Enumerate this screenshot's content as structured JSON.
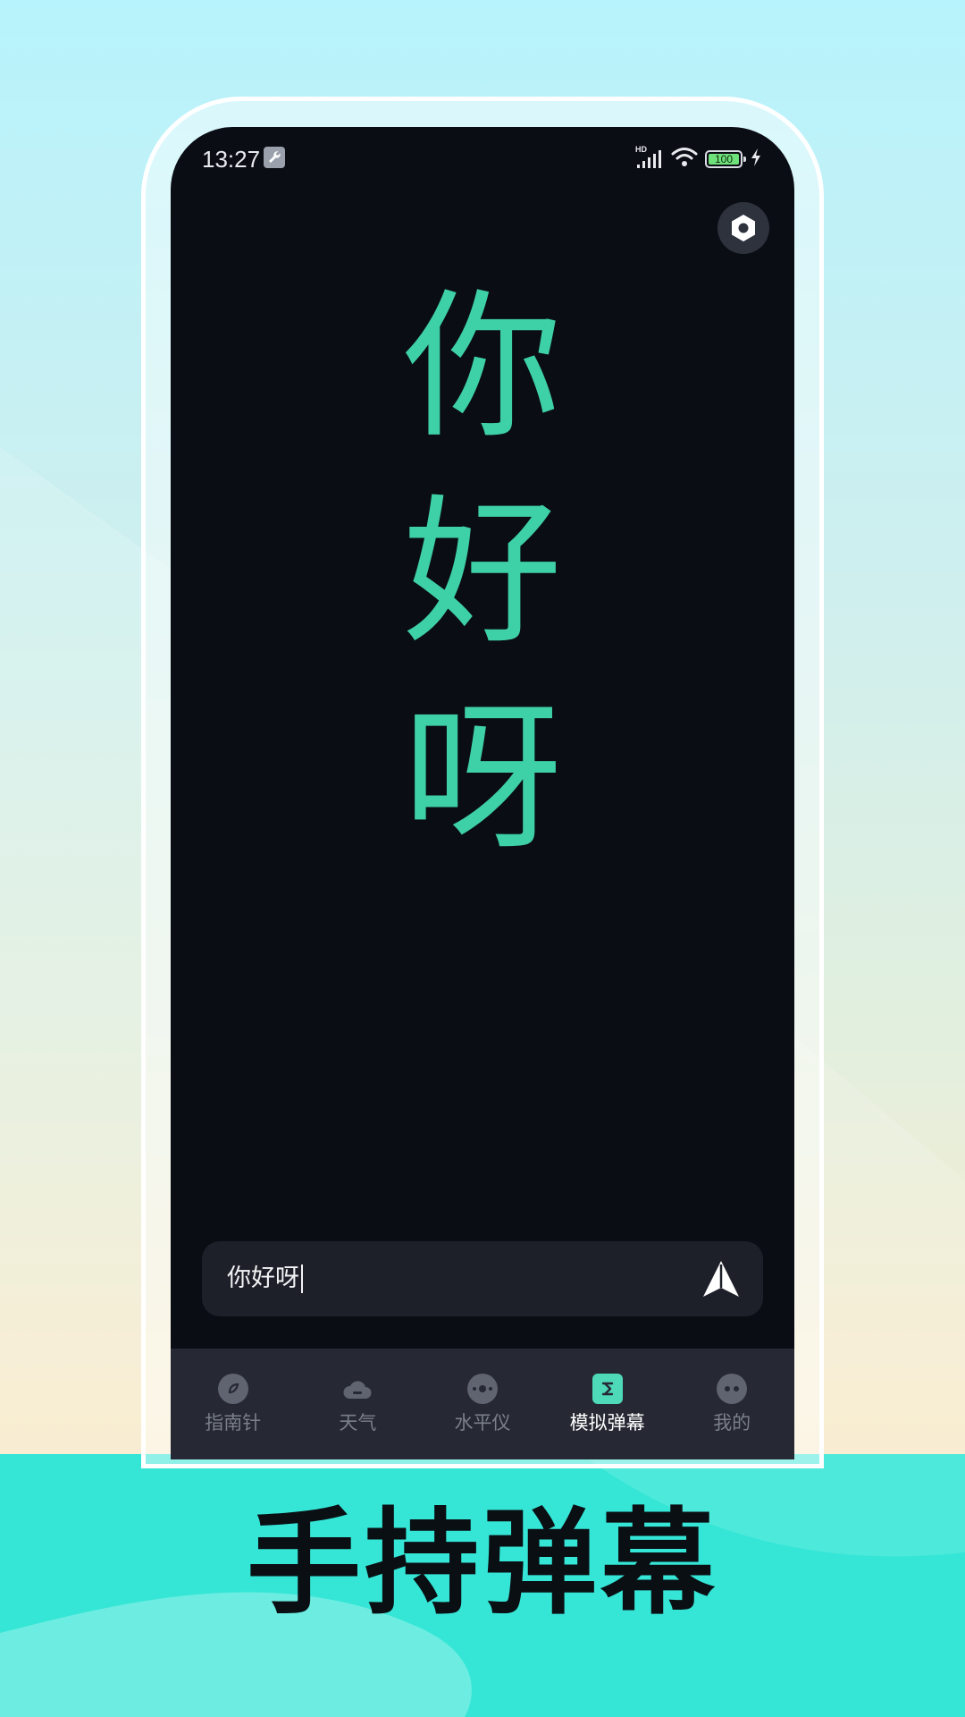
{
  "status_bar": {
    "time": "13:27",
    "signal_badge": "HD",
    "battery_level": "100"
  },
  "danmaku": {
    "characters": [
      "你",
      "好",
      "呀"
    ],
    "color": "#3ed0a6"
  },
  "input": {
    "value": "你好呀"
  },
  "tabs": [
    {
      "label": "指南针",
      "icon": "compass-icon",
      "active": false
    },
    {
      "label": "天气",
      "icon": "cloud-icon",
      "active": false
    },
    {
      "label": "水平仪",
      "icon": "level-icon",
      "active": false
    },
    {
      "label": "模拟弹幕",
      "icon": "danmaku-icon",
      "active": true
    },
    {
      "label": "我的",
      "icon": "profile-icon",
      "active": false
    }
  ],
  "slogan": "手持弹幕",
  "colors": {
    "accent": "#3ed0a6",
    "screen_bg": "#0a0d14",
    "bottom_bg": "#35e6d6"
  }
}
